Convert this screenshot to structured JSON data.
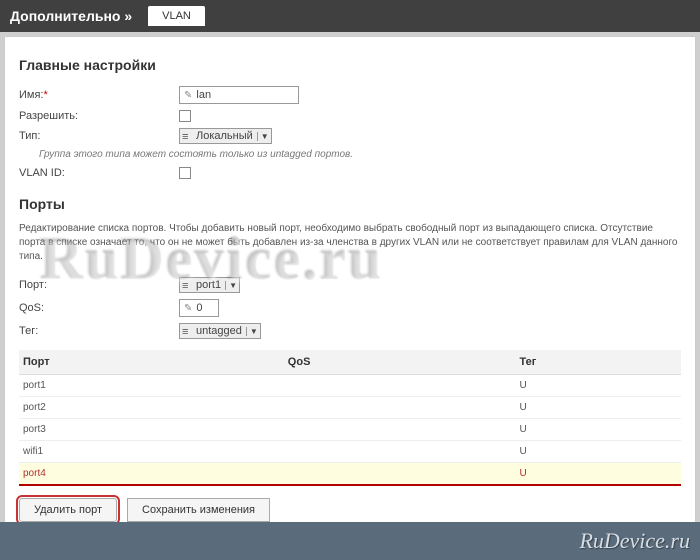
{
  "header": {
    "title": "Дополнительно »",
    "tab": "VLAN"
  },
  "main_settings": {
    "heading": "Главные настройки",
    "name_label": "Имя:",
    "name_value": "lan",
    "allow_label": "Разрешить:",
    "type_label": "Тип:",
    "type_value": "Локальный",
    "type_hint": "Группа этого типа может состоять только из untagged портов.",
    "vlanid_label": "VLAN ID:"
  },
  "ports_section": {
    "heading": "Порты",
    "description": "Редактирование списка портов. Чтобы добавить новый порт, необходимо выбрать свободный порт из выпадающего списка. Отсутствие порта в списке означает то, что он не может быть добавлен из-за членства в других VLAN или не соответствует правилам для VLAN данного типа.",
    "port_label": "Порт:",
    "port_value": "port1",
    "qos_label": "QoS:",
    "qos_value": "0",
    "tag_label": "Тег:",
    "tag_value": "untagged"
  },
  "table": {
    "columns": [
      "Порт",
      "QoS",
      "Тег"
    ],
    "rows": [
      {
        "port": "port1",
        "qos": "",
        "tag": "U",
        "selected": false
      },
      {
        "port": "port2",
        "qos": "",
        "tag": "U",
        "selected": false
      },
      {
        "port": "port3",
        "qos": "",
        "tag": "U",
        "selected": false
      },
      {
        "port": "wifi1",
        "qos": "",
        "tag": "U",
        "selected": false
      },
      {
        "port": "port4",
        "qos": "",
        "tag": "U",
        "selected": true
      }
    ]
  },
  "buttons": {
    "delete_port": "Удалить порт",
    "save_changes": "Сохранить изменения"
  },
  "watermark": {
    "big": "RuDevice.ru",
    "small": "RuDevice.ru"
  }
}
